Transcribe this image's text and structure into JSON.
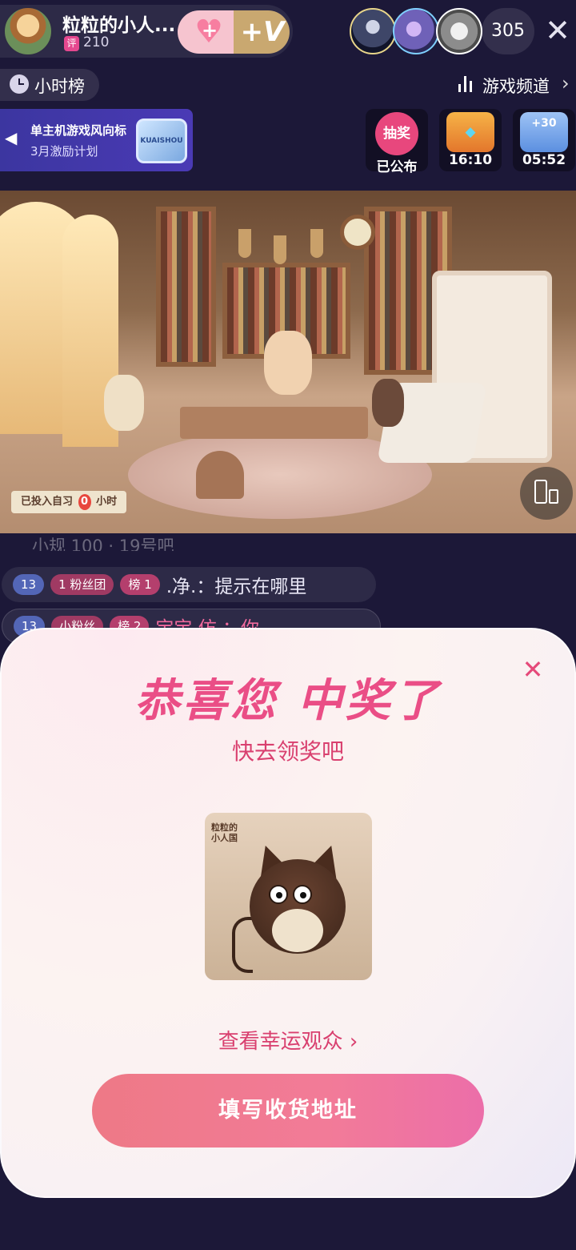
{
  "host": {
    "name": "粒粒的小人...",
    "tag": "评",
    "score": "210",
    "follow_plus": "+",
    "follow_vip": "+V"
  },
  "audience": {
    "count": "305",
    "close": "✕"
  },
  "rank": {
    "label": "小时榜"
  },
  "channel": {
    "label": "游戏频道",
    "arrow": "›"
  },
  "banner": {
    "title": "单主机游戏风向标",
    "subtitle": "3月激励计划",
    "arrow": "◀",
    "tv_text": "KUAISHOU"
  },
  "activities": [
    {
      "icon_text": "抽奖",
      "label": "已公布",
      "color": "#e8477d"
    },
    {
      "icon_text": "◆",
      "label": "16:10",
      "color": "#f0a33c"
    },
    {
      "icon_text": "+30",
      "label": "05:52",
      "color": "#6a9ee8"
    }
  ],
  "video": {
    "tag_prefix": "已投入自习",
    "tag_value": "0",
    "tag_suffix": "小时"
  },
  "chat": {
    "ghost": "小规 100 · 19号吧",
    "rows": [
      {
        "level": "13",
        "fan_badge": "粉丝团",
        "fan_level": "1",
        "rank_badge": "榜 1",
        "text": ".净.：提示在哪里"
      },
      {
        "level": "13",
        "fan_badge": "小粉丝",
        "fan_level": "",
        "rank_badge": "榜 2",
        "text": "宝宝 仿 ：你"
      }
    ]
  },
  "modal": {
    "close": "✕",
    "title": "恭喜您 中奖了",
    "subtitle": "快去领奖吧",
    "prize_brand": "粒粒的小人国",
    "lucky_link": "查看幸运观众 ›",
    "claim_button": "填写收货地址"
  },
  "colors": {
    "accent": "#ea4e86",
    "button_start": "#ee7986",
    "button_end": "#ec6ea9",
    "background": "#1c1838"
  }
}
